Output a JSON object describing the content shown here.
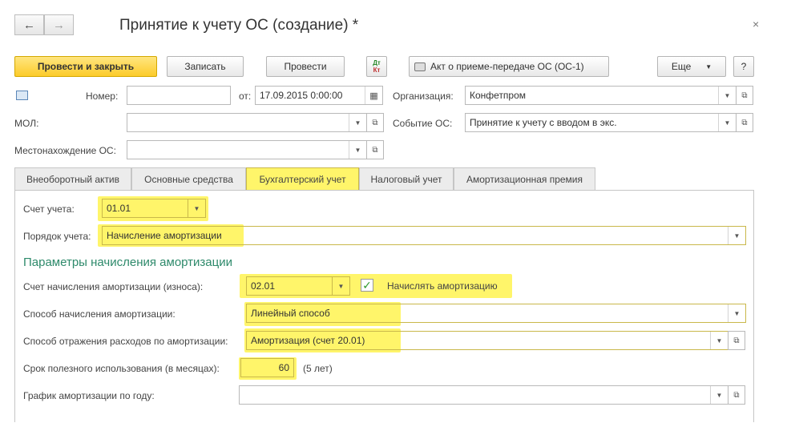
{
  "window": {
    "title": "Принятие к учету ОС (создание) *",
    "back_icon": "←",
    "forward_icon": "→",
    "close_icon": "×"
  },
  "toolbar": {
    "post_close": "Провести и закрыть",
    "save": "Записать",
    "post": "Провести",
    "dtkt_top": "Дт",
    "dtkt_bottom": "Кт",
    "print_act": "Акт о приеме-передаче ОС (ОС-1)",
    "more": "Еще",
    "more_arrow": "▼",
    "help": "?"
  },
  "header": {
    "number_label": "Номер:",
    "number_value": "",
    "from_label": "от:",
    "date_value": "17.09.2015  0:00:00",
    "org_label": "Организация:",
    "org_value": "Конфетпром",
    "mol_label": "МОЛ:",
    "mol_value": "",
    "event_label": "Событие ОС:",
    "event_value": "Принятие к учету с вводом в экс.",
    "location_label": "Местонахождение ОС:",
    "location_value": ""
  },
  "tabs": [
    {
      "label": "Внеоборотный актив"
    },
    {
      "label": "Основные средства"
    },
    {
      "label": "Бухгалтерский учет"
    },
    {
      "label": "Налоговый учет"
    },
    {
      "label": "Амортизационная премия"
    }
  ],
  "accounting": {
    "account_label": "Счет учета:",
    "account_value": "01.01",
    "order_label": "Порядок учета:",
    "order_value": "Начисление амортизации",
    "section_title": "Параметры начисления амортизации",
    "depr_account_label": "Счет начисления амортизации (износа):",
    "depr_account_value": "02.01",
    "accrue_label": "Начислять амортизацию",
    "accrue_checked": "✓",
    "method_label": "Способ начисления амортизации:",
    "method_value": "Линейный способ",
    "expense_label": "Способ отражения расходов по амортизации:",
    "expense_value": "Амортизация (счет 20.01)",
    "life_label": "Срок полезного использования (в месяцах):",
    "life_value": "60",
    "life_years": "(5 лет)",
    "schedule_label": "График амортизации по году:",
    "schedule_value": ""
  },
  "icons": {
    "dropdown": "▼",
    "open": "⧉",
    "calendar": "▦"
  }
}
